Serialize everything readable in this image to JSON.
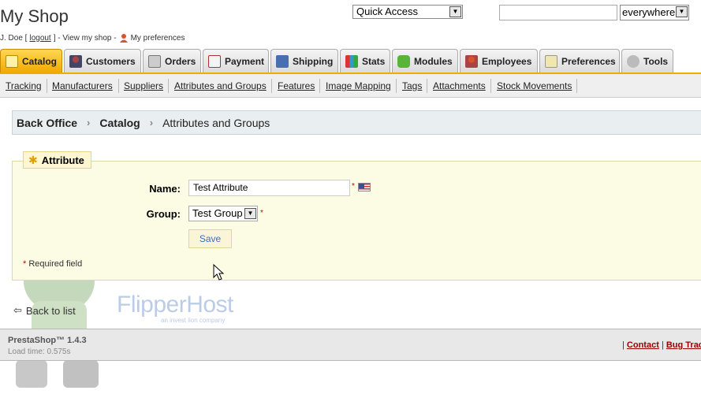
{
  "header": {
    "title": "My Shop",
    "user_name": "J. Doe [",
    "logout_label": "logout",
    "user_suffix": "] - View my shop -",
    "preferences_label": "My preferences",
    "quick_access": "Quick Access",
    "search_value": "",
    "search_scope": "everywhere"
  },
  "tabs": [
    {
      "label": "Catalog",
      "icon": "catalog-icon",
      "active": true
    },
    {
      "label": "Customers",
      "icon": "customers-icon"
    },
    {
      "label": "Orders",
      "icon": "orders-icon"
    },
    {
      "label": "Payment",
      "icon": "payment-icon"
    },
    {
      "label": "Shipping",
      "icon": "shipping-icon"
    },
    {
      "label": "Stats",
      "icon": "stats-icon"
    },
    {
      "label": "Modules",
      "icon": "modules-icon"
    },
    {
      "label": "Employees",
      "icon": "employees-icon"
    },
    {
      "label": "Preferences",
      "icon": "preferences-icon"
    },
    {
      "label": "Tools",
      "icon": "tools-icon"
    }
  ],
  "submenu": [
    {
      "label": "Tracking"
    },
    {
      "label": "Manufacturers"
    },
    {
      "label": "Suppliers"
    },
    {
      "label": "Attributes and Groups"
    },
    {
      "label": "Features"
    },
    {
      "label": "Image Mapping"
    },
    {
      "label": "Tags"
    },
    {
      "label": "Attachments"
    },
    {
      "label": "Stock Movements"
    }
  ],
  "breadcrumb": [
    "Back Office",
    "Catalog",
    "Attributes and Groups"
  ],
  "form": {
    "legend": "Attribute",
    "name_label": "Name:",
    "name_value": "Test Attribute",
    "group_label": "Group:",
    "group_value": "Test Group",
    "required_mark": "*",
    "save_label": "Save",
    "required_note": "Required field"
  },
  "back_label": "Back to list",
  "footer": {
    "version": "PrestaShop™ 1.4.3",
    "load_time": "Load time: 0.575s",
    "sep": "|",
    "contact": "Contact",
    "bug": "Bug Tracker"
  },
  "watermark": {
    "name": "FlipperHost",
    "tagline": "an invest lion company"
  },
  "colors": {
    "active_tab": "#f2a900",
    "breadcrumb_bg": "#e9eff1",
    "form_bg": "#fcfbe4",
    "link_red": "#990000"
  }
}
